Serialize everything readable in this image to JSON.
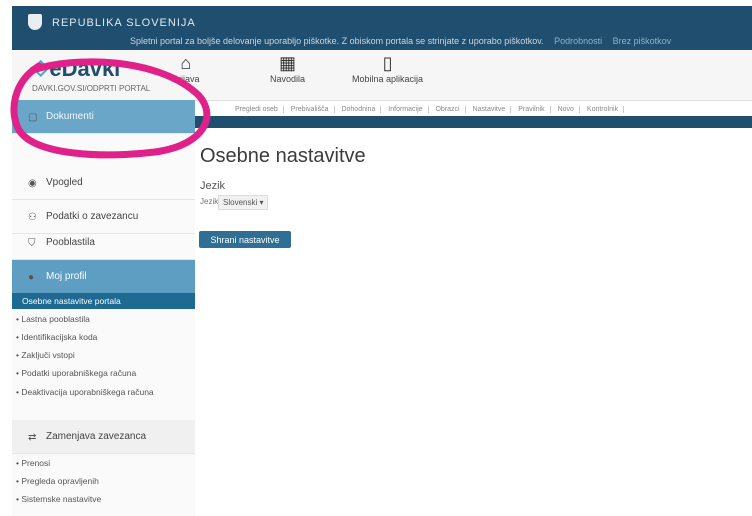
{
  "header": {
    "republic_label": "REPUBLIKA SLOVENIJA",
    "announcement": "Spletni portal za boljše delovanje uporabljo piškotke. Z obiskom portala se strinjate z uporabo piškotkov.",
    "announcement_links": [
      "Podrobnosti",
      "Brez piškotkov"
    ]
  },
  "nav": {
    "logo": "eDavki",
    "logo_sub": "DAVKI.GOV.SI/ODPRTI PORTAL",
    "items": [
      {
        "label": "Prijava",
        "icon": "home-icon"
      },
      {
        "label": "Navodila",
        "icon": "grid-icon"
      },
      {
        "label": "Mobilna aplikacija",
        "icon": "mobile-icon"
      }
    ]
  },
  "subnav": [
    "Pregledi oseb",
    "Prebivališča",
    "Dohodnina",
    "Informacije",
    "Obrazci",
    "Nastavitve",
    "Pravilnik",
    "Novo",
    "Kontrolnik"
  ],
  "sidebar": {
    "items": [
      {
        "label": "Dokumenti",
        "icon": "document-icon",
        "active": true
      },
      {
        "label": "Vpogled",
        "icon": "eye-icon"
      },
      {
        "label": "Podatki o zavezancu",
        "icon": "people-icon"
      },
      {
        "label": "Pooblastila",
        "icon": "shield-icon"
      },
      {
        "label": "Moj profil",
        "icon": "user-icon",
        "section": true
      }
    ],
    "profile_links": [
      "Osebne nastavitve portala",
      "Lastna pooblastila",
      "Identifikacijska koda",
      "Zaključi vstopi",
      "Podatki uporabniškega računa",
      "Deaktivacija uporabniškega računa"
    ],
    "section2": {
      "label": "Zamenjava zavezanca",
      "icon": "switch-icon"
    },
    "section2_links": [
      "Prenosi",
      "Pregleda opravljenih",
      "Sistemske nastavitve"
    ]
  },
  "content": {
    "title": "Osebne nastavitve",
    "language_heading": "Jezik",
    "language_label": "Jezik",
    "language_value": "Slovenski ▾",
    "save_button": "Shrani nastavitve"
  },
  "colors": {
    "header_bg": "#1f4e6e",
    "sidebar_active": "#6aa6c7",
    "annotation": "#e0218a"
  }
}
